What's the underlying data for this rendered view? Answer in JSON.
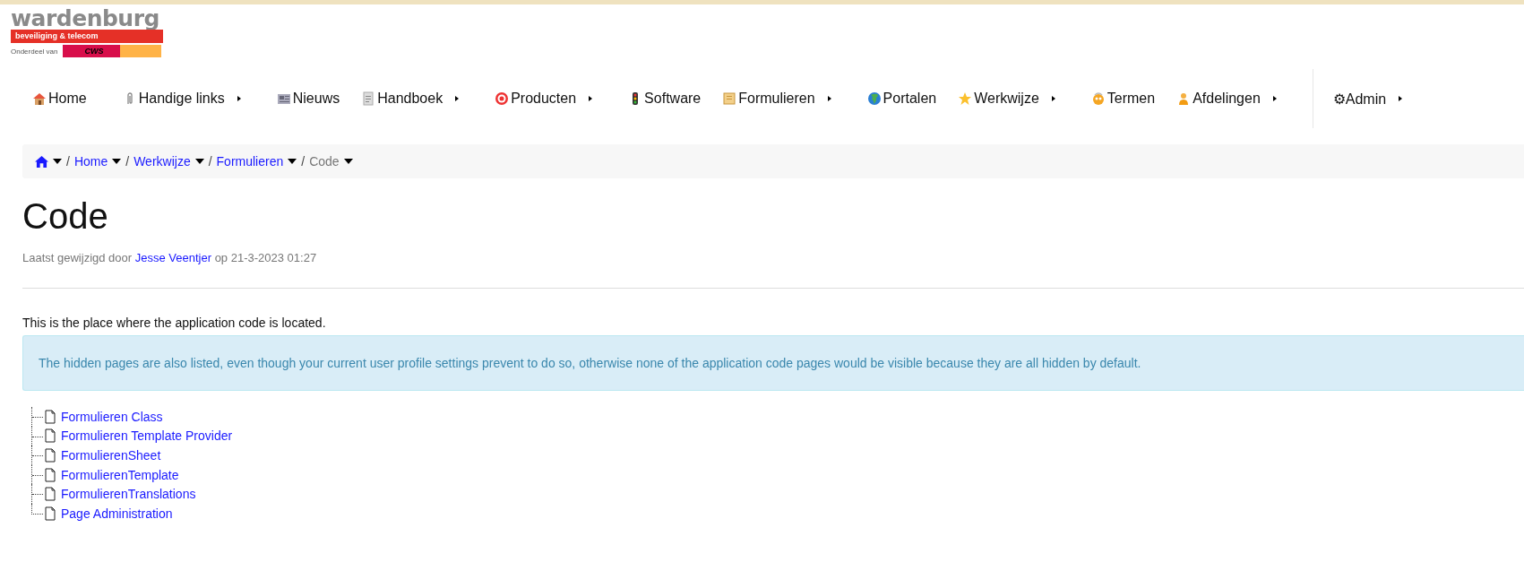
{
  "logo": {
    "name": "wardenburg",
    "tagline": "beveiliging & telecom",
    "parent_label": "Onderdeel van",
    "parent_name": "CWS"
  },
  "nav": [
    {
      "label": "Home",
      "has_submenu": false
    },
    {
      "label": "Handige links",
      "has_submenu": true
    },
    {
      "label": "Nieuws",
      "has_submenu": false
    },
    {
      "label": "Handboek",
      "has_submenu": true
    },
    {
      "label": "Producten",
      "has_submenu": true
    },
    {
      "label": "Software",
      "has_submenu": false
    },
    {
      "label": "Formulieren",
      "has_submenu": true
    },
    {
      "label": "Portalen",
      "has_submenu": false
    },
    {
      "label": "Werkwijze",
      "has_submenu": true
    },
    {
      "label": "Termen",
      "has_submenu": false
    },
    {
      "label": "Afdelingen",
      "has_submenu": true
    }
  ],
  "admin": {
    "label": "⚙Admin",
    "has_submenu": true
  },
  "breadcrumb": [
    {
      "separator": "/",
      "label": "Home",
      "current": false
    },
    {
      "separator": "/",
      "label": "Werkwijze",
      "current": false
    },
    {
      "separator": "/",
      "label": "Formulieren",
      "current": false
    },
    {
      "separator": "/",
      "label": "Code",
      "current": true
    }
  ],
  "title": "Code",
  "meta": {
    "prefix": "Laatst gewijzigd door",
    "author": "Jesse Veentjer",
    "suffix": "op 21-3-2023 01:27"
  },
  "intro": "This is the place where the application code is located.",
  "info": "The hidden pages are also listed, even though your current user profile settings prevent to do so, otherwise none of the application code pages would be visible because they are all hidden by default.",
  "tree": [
    {
      "label": "Formulieren Class"
    },
    {
      "label": "Formulieren Template Provider"
    },
    {
      "label": "FormulierenSheet"
    },
    {
      "label": "FormulierenTemplate"
    },
    {
      "label": "FormulierenTranslations"
    },
    {
      "label": "Page Administration"
    }
  ]
}
